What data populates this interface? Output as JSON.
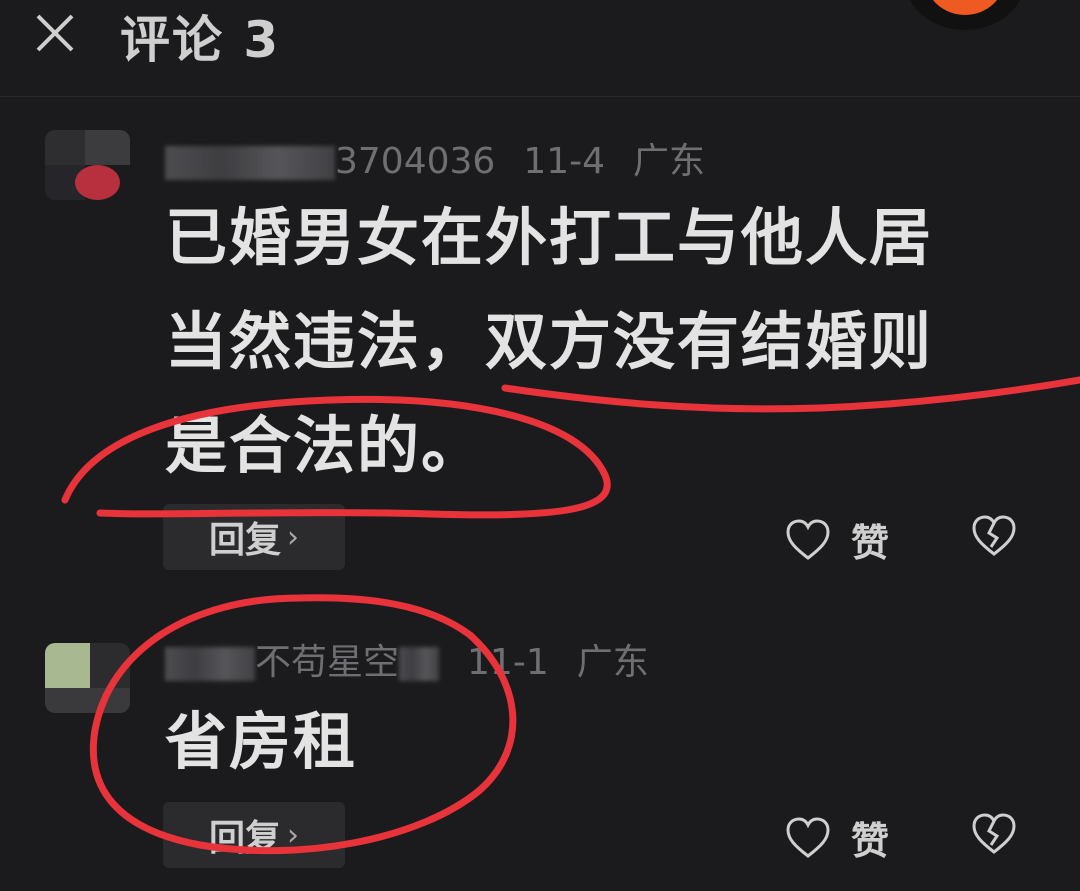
{
  "header": {
    "title": "评论 3",
    "close_icon": "close-icon"
  },
  "comments": [
    {
      "username_visible": "3704036",
      "date": "11-4",
      "location": "广东",
      "text_line1": "已婚男女在外打工与他人居",
      "text_line2": "当然违法，双方没有结婚则",
      "text_line3": "是合法的。",
      "reply_label": "回复",
      "like_label": "赞"
    },
    {
      "username_visible": "不苟星空",
      "date": "11-1",
      "location": "广东",
      "text_line1": "省房租",
      "reply_label": "回复",
      "like_label": "赞"
    }
  ],
  "colors": {
    "background": "#1b1b1d",
    "text": "#e3e3e3",
    "meta": "#6f6f73",
    "annotation": "#e8333a",
    "accent_avatar": "#ef5a22"
  }
}
